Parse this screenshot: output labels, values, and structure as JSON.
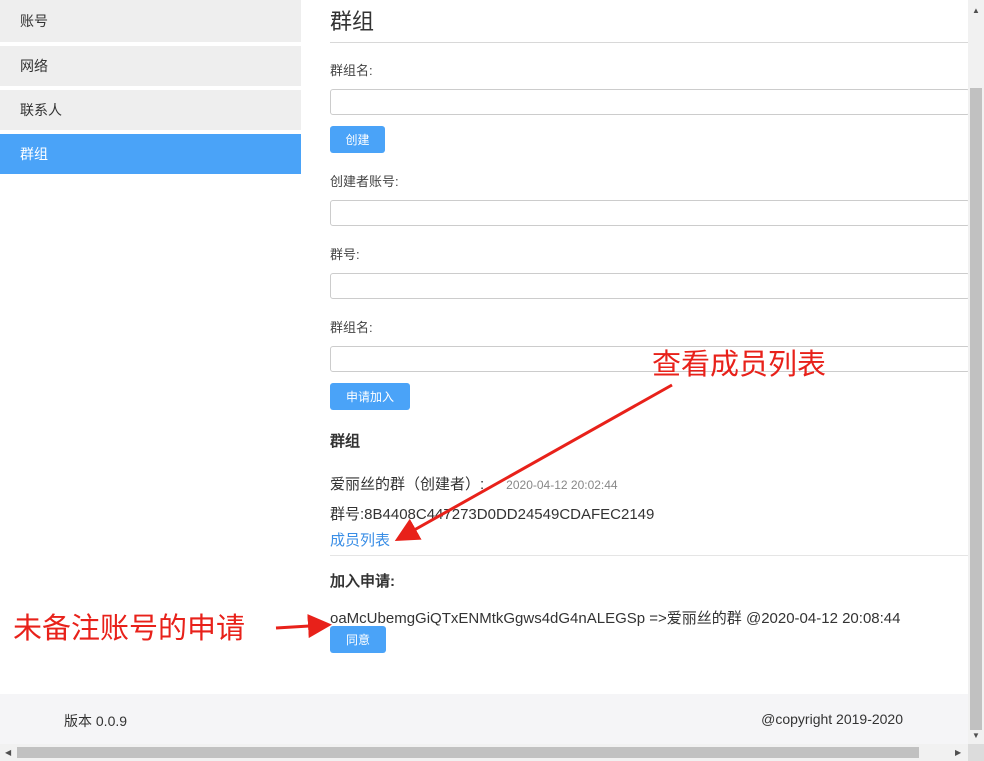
{
  "sidebar": {
    "items": [
      {
        "label": "账号"
      },
      {
        "label": "网络"
      },
      {
        "label": "联系人"
      },
      {
        "label": "群组"
      }
    ]
  },
  "main": {
    "title": "群组",
    "create_group_label": "群组名:",
    "create_button": "创建",
    "creator_account_label": "创建者账号:",
    "group_id_label": "群号:",
    "join_group_name_label": "群组名:",
    "apply_join_button": "申请加入",
    "groups_heading": "群组",
    "group": {
      "name": "爱丽丝的群（创建者）:",
      "time": "2020-04-12 20:02:44",
      "id_line": "群号:8B4408C447273D0DD24549CDAFEC2149",
      "member_list_link": "成员列表"
    },
    "join_requests_heading": "加入申请:",
    "request": {
      "text": "oaMcUbemgGiQTxENMtkGgws4dG4nALEGSp =>爱丽丝的群 @2020-04-12 20:08:44",
      "agree_button": "同意"
    }
  },
  "footer": {
    "version": "版本 0.0.9",
    "copyright": "@copyright 2019-2020"
  },
  "annotations": {
    "view_members": "查看成员列表",
    "unregistered_request": "未备注账号的申请"
  },
  "colors": {
    "accent": "#4aa3f8",
    "link": "#3a8ee6",
    "annotation": "#e8211a"
  }
}
